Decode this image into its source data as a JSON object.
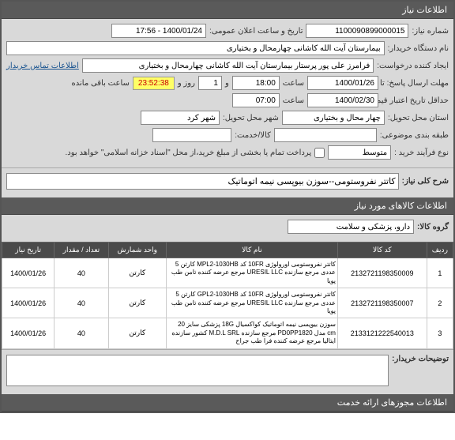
{
  "header": {
    "title": "اطلاعات نیاز"
  },
  "info": {
    "niaz_no_label": "شماره نیاز:",
    "niaz_no": "1100090899000015",
    "public_time_label": "تاریخ و ساعت اعلان عمومی:",
    "public_time": "1400/01/24 - 17:56",
    "buyer_label": "نام دستگاه خریدار:",
    "buyer": "بیمارستان آیت الله کاشانی چهارمحال و بختیاری",
    "creator_label": "ایجاد کننده درخواست:",
    "creator": "فرامرز علی پور پرستار بیمارستان آیت الله کاشانی چهارمحال و بختیاری",
    "contact_link": "اطلاعات تماس خریدار",
    "deadline_from_label": "مهلت ارسال پاسخ: تا تاریخ:",
    "deadline_from": "1400/01/26",
    "deadline_time_label": "ساعت",
    "deadline_time": "18:00",
    "day_label": "و",
    "days": "1",
    "day_unit": "روز و",
    "timer": "23:52:38",
    "remaining": "ساعت باقی مانده",
    "price_valid_label": "حداقل تاریخ اعتبار قیمت: تا تاریخ:",
    "price_valid": "1400/02/30",
    "price_valid_time": "07:00",
    "province_label": "استان محل تحویل:",
    "province": "چهار محال و بختیاری",
    "city_label": "شهر محل تحویل:",
    "city": "شهر کرد",
    "budget_label": "طبقه بندی موضوعی:",
    "service_label": "کالا/خدمت:",
    "process_label": "نوع فرآیند خرید :",
    "process": "متوسط",
    "payment_note": "پرداخت تمام یا بخشی از مبلغ خرید،از محل \"اسناد خزانه اسلامی\" خواهد بود."
  },
  "desc": {
    "title_label": "شرح کلی نیاز:",
    "title": "کاتتر نفروستومی--سوزن بیوپسی نیمه اتوماتیک"
  },
  "goods_section": "اطلاعات کالاهای مورد نیاز",
  "group": {
    "label": "گروه کالا:",
    "value": "دارو، پزشکی و سلامت"
  },
  "table": {
    "headers": {
      "row": "ردیف",
      "code": "کد کالا",
      "name": "نام کالا",
      "unit": "واحد شمارش",
      "qty": "تعداد / مقدار",
      "date": "تاریخ نیاز"
    },
    "rows": [
      {
        "idx": "1",
        "code": "2132721198350009",
        "name": "کاتتر نفروستومی اورولوژی 10FR کد MPL2-1030HB کارتن 5 عددی مرجع سازنده URESIL LLC مرجع عرضه کننده تامن طب پویا",
        "unit": "کارتن",
        "qty": "40",
        "date": "1400/01/26"
      },
      {
        "idx": "2",
        "code": "2132721198350007",
        "name": "کاتتر نفروستومی اورولوژی 10FR کد GPL2-1030HB کارتن 5 عددی مرجع سازنده URESIL LLC مرجع عرضه کننده تامن طب پویا",
        "unit": "کارتن",
        "qty": "40",
        "date": "1400/01/26"
      },
      {
        "idx": "3",
        "code": "2133121222540013",
        "name": "سوزن بیوپسی نیمه اتوماتیک کواکسیال 18G پزشکی سایز 20 cm مدل PD0PP1820 مرجع سازنده M.D.L SRL کشور سازنده ایتالیا مرجع عرضه کننده فرا طب جراح",
        "unit": "کارتن",
        "qty": "40",
        "date": "1400/01/26"
      }
    ]
  },
  "buyer_desc_label": "توضیحات خریدار:",
  "footer": "اطلاعات مجوزهای ارائه خدمت"
}
